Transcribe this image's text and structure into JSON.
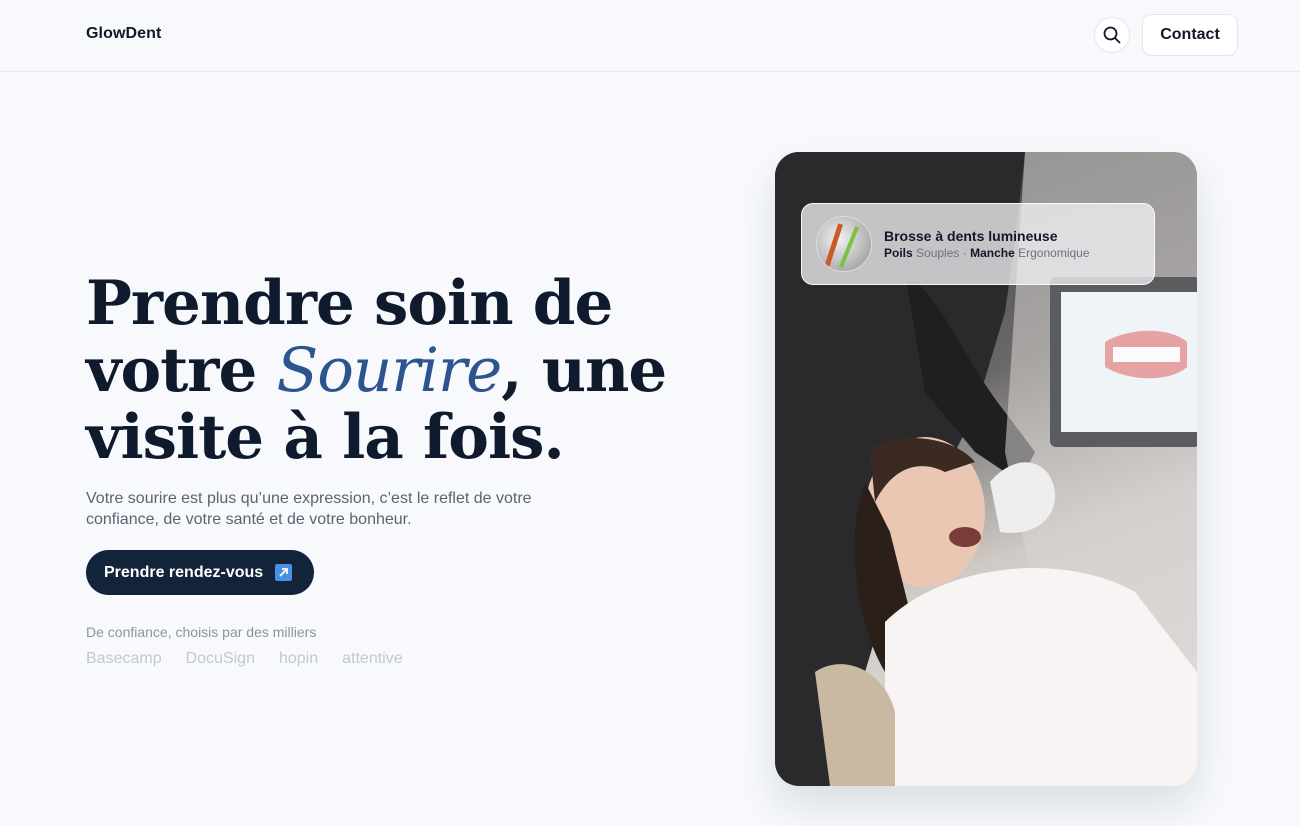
{
  "header": {
    "logo": "GlowDent",
    "contact_label": "Contact"
  },
  "hero": {
    "title_before": "Prendre soin de votre ",
    "title_accent": "Sourire",
    "title_after": ", une visite à la fois.",
    "subtitle": "Votre sourire est plus qu’une expression, c’est le reflet de votre confiance, de votre santé et de votre bonheur.",
    "cta_label": "Prendre rendez-vous",
    "trusted_label": "De confiance, choisis par des milliers",
    "logos": [
      "Basecamp",
      "DocuSign",
      "hopin",
      "attentive"
    ]
  },
  "product": {
    "name": "Brosse à dents lumineuse",
    "spec1_key": "Poils",
    "spec1_value": "Souples",
    "separator": "·",
    "spec2_key": "Manche",
    "spec2_value": "Ergonomique"
  },
  "colors": {
    "accent": "#2c5590",
    "cta_bg": "#13233a",
    "cta_icon": "#4a90e2",
    "page_bg": "#f7f9fc"
  },
  "icons": {
    "search": "search-icon",
    "cta_arrow": "arrow-up-right-icon"
  }
}
